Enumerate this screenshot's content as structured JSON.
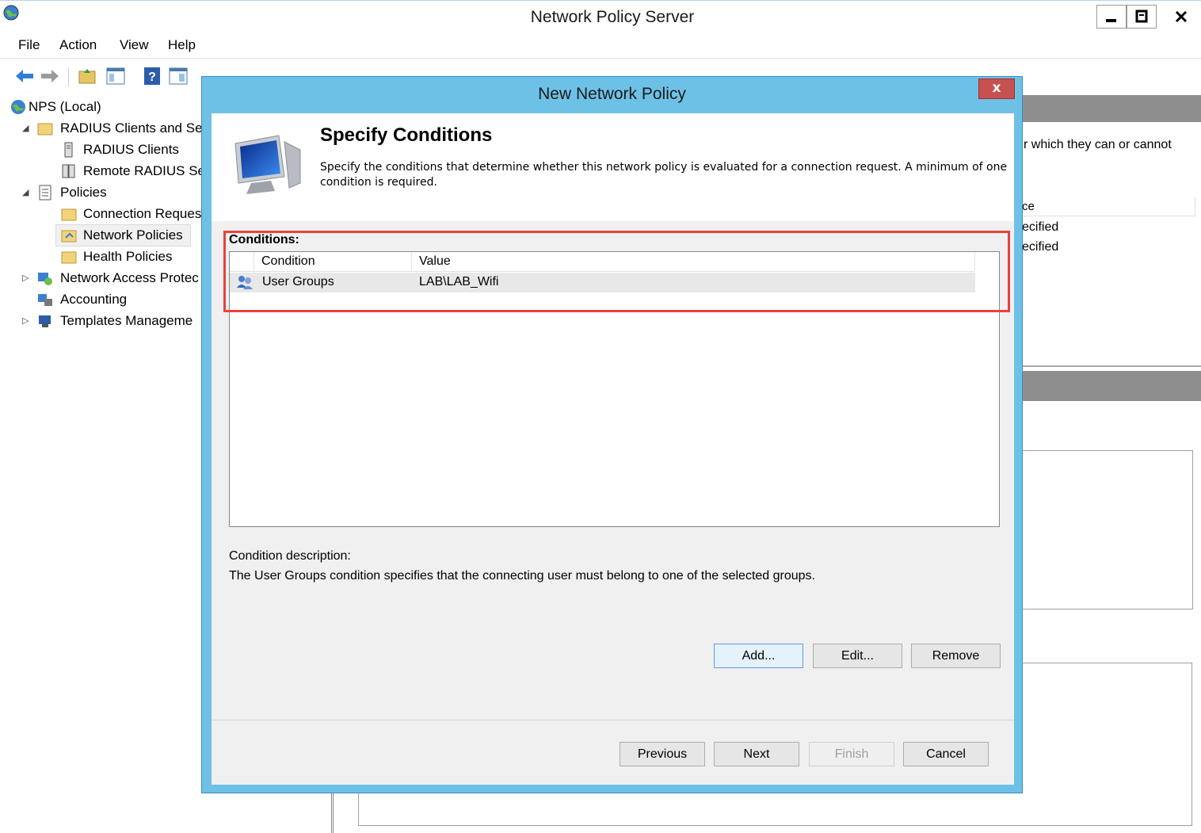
{
  "main_window": {
    "title": "Network Policy Server",
    "menu": [
      "File",
      "Action",
      "View",
      "Help"
    ],
    "tree": [
      {
        "label": "NPS (Local)",
        "icon": "globe-icon"
      },
      {
        "label": "RADIUS Clients and Ser",
        "icon": "folder-icon",
        "expander": "◢"
      },
      {
        "label": "RADIUS Clients",
        "icon": "server-icon"
      },
      {
        "label": "Remote RADIUS Se",
        "icon": "server-group-icon"
      },
      {
        "label": "Policies",
        "icon": "document-icon",
        "expander": "◢"
      },
      {
        "label": "Connection Reques",
        "icon": "folder-icon"
      },
      {
        "label": "Network Policies",
        "icon": "folder-policy-icon"
      },
      {
        "label": "Health Policies",
        "icon": "folder-icon"
      },
      {
        "label": "Network Access Protec",
        "icon": "nap-icon",
        "expander": "▷"
      },
      {
        "label": "Accounting",
        "icon": "accounting-icon"
      },
      {
        "label": "Templates Manageme",
        "icon": "templates-icon",
        "expander": "▷"
      }
    ],
    "right_pane": {
      "desc_fragment": "r which they can or cannot",
      "col_fragment": "ce",
      "row1_fragment": "ecified",
      "row2_fragment": "ecified"
    }
  },
  "dialog": {
    "title": "New Network Policy",
    "close_label": "x",
    "header_title": "Specify Conditions",
    "header_desc": "Specify the conditions that determine whether this network policy is evaluated for a connection request. A minimum of one condition is required.",
    "conditions_label": "Conditions:",
    "columns": {
      "condition": "Condition",
      "value": "Value"
    },
    "rows": [
      {
        "condition": "User Groups",
        "value": "LAB\\LAB_Wifi",
        "icon": "user-group-icon"
      }
    ],
    "condition_description_label": "Condition description:",
    "condition_description": "The User Groups condition specifies that the connecting user must belong to one of the selected groups.",
    "buttons": {
      "add": "Add...",
      "edit": "Edit...",
      "remove": "Remove",
      "previous": "Previous",
      "next": "Next",
      "finish": "Finish",
      "cancel": "Cancel"
    }
  },
  "colors": {
    "dialog_frame": "#6ec1e6",
    "highlight_border": "#e8423a",
    "close_button": "#c75050"
  }
}
